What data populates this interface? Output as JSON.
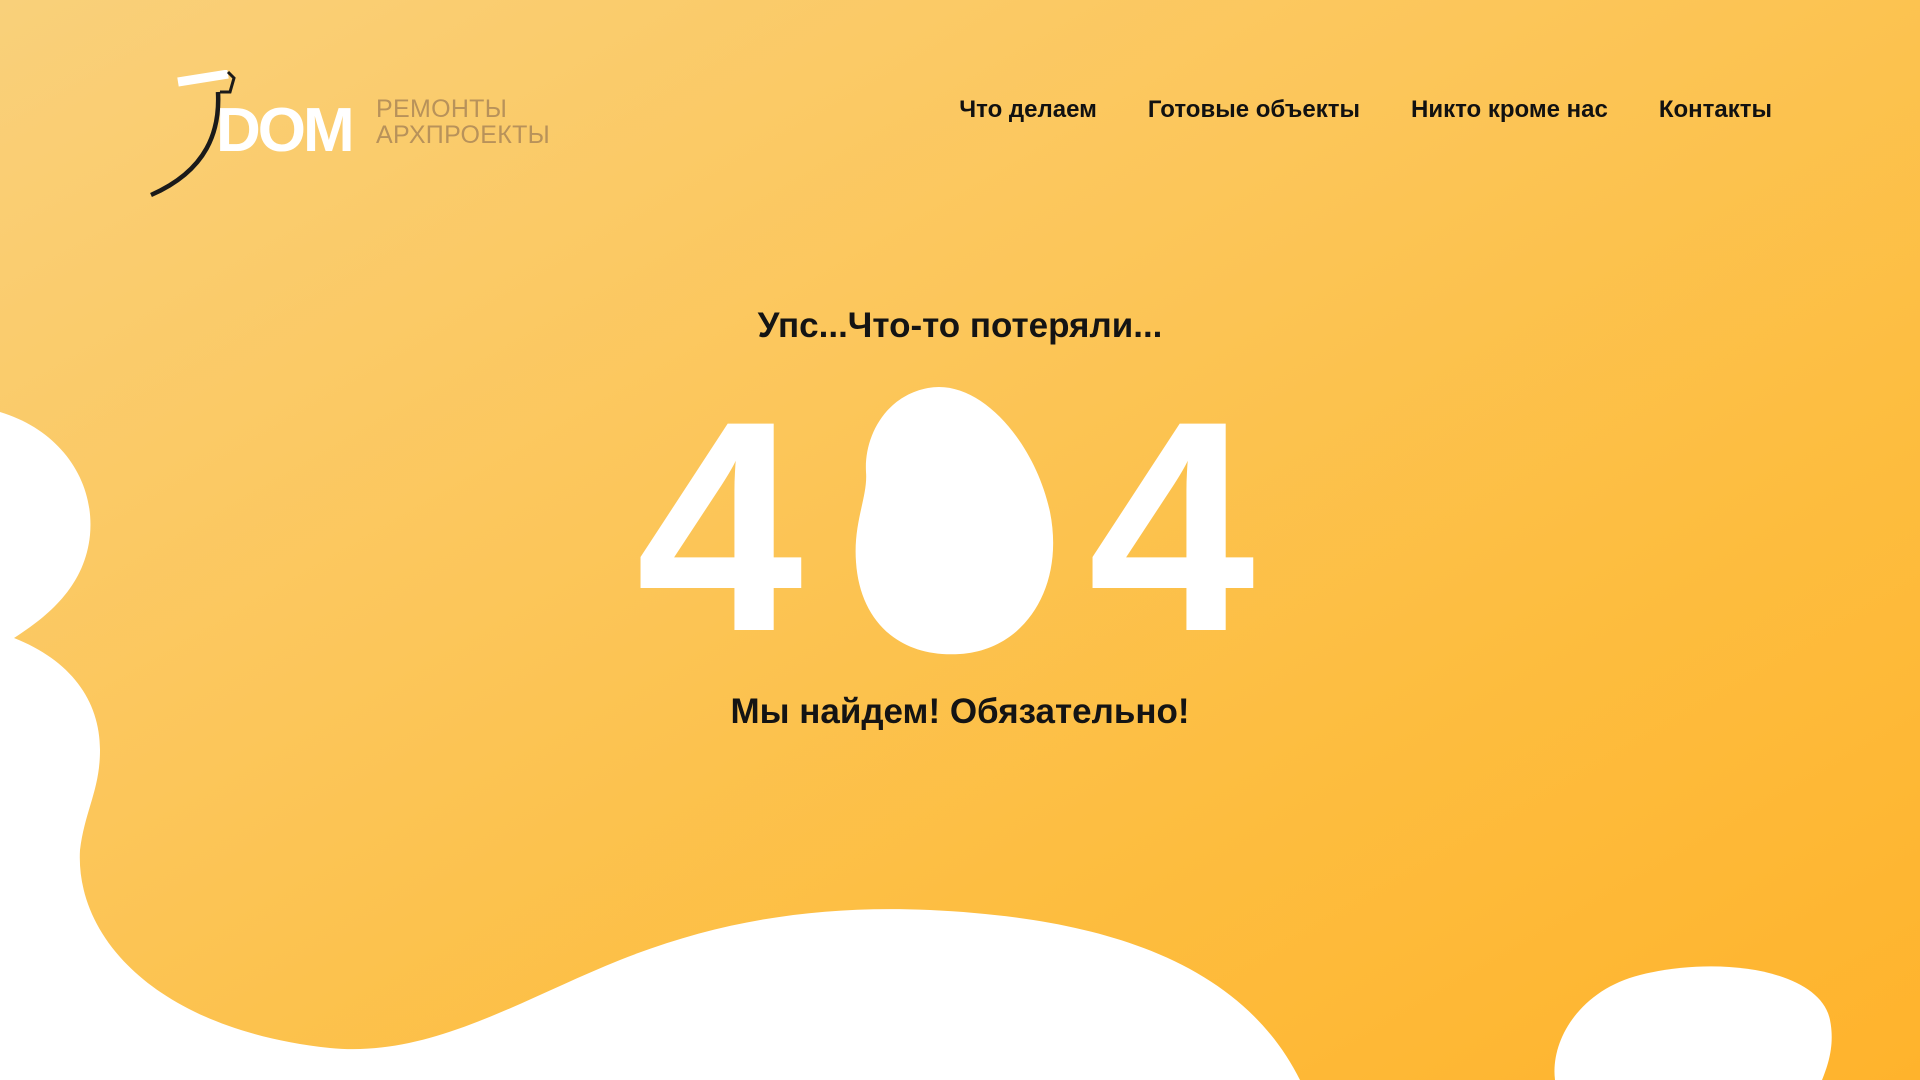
{
  "colors": {
    "accent": "#fdbd3f",
    "text": "#141414",
    "white": "#ffffff",
    "logo_sub": "#b8925a"
  },
  "header": {
    "logo": {
      "brand": "DOM",
      "line1": "РЕМОНТЫ",
      "line2": "АРХПРОЕКТЫ",
      "icon": "paint-roller-icon"
    },
    "nav": [
      {
        "label": "Что делаем"
      },
      {
        "label": "Готовые объекты"
      },
      {
        "label": "Никто кроме нас"
      },
      {
        "label": "Контакты"
      }
    ]
  },
  "main": {
    "headline": "Упс...Что-то потеряли...",
    "code_left": "4",
    "code_middle_icon": "egg-blob-icon",
    "code_right": "4",
    "subline": "Мы найдем! Обязательно!"
  }
}
